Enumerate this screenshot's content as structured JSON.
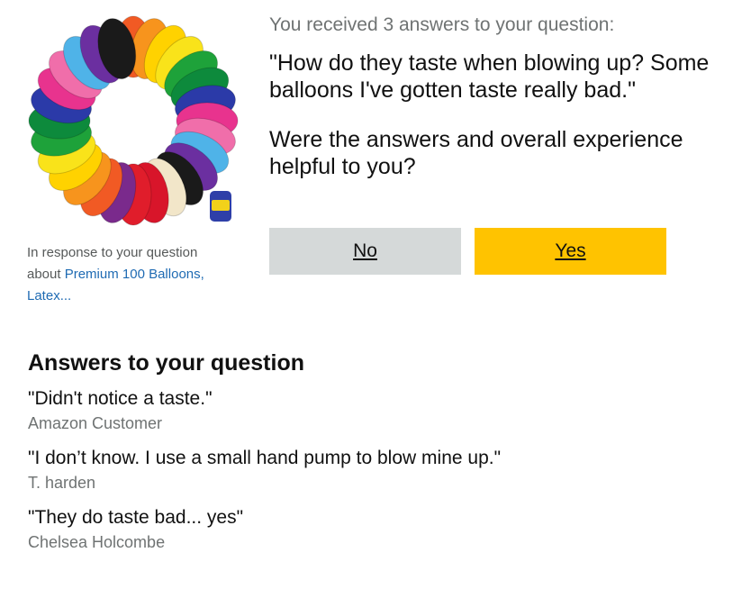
{
  "product": {
    "image_alt": "balloon-ring",
    "caption_prefix": "In response to your question about ",
    "link_text": "Premium 100 Balloons, Latex...",
    "balloon_colors": [
      "#f15a24",
      "#f7941d",
      "#ffd200",
      "#f9e31a",
      "#1ea23a",
      "#0d8a3c",
      "#2b3aa8",
      "#e8338e",
      "#f06eaa",
      "#4fb3e8",
      "#6b2fa0",
      "#1a1a1a",
      "#f2e6c9",
      "#d8152a",
      "#e01d2b",
      "#7a2a8c"
    ]
  },
  "header": {
    "received": "You received 3 answers to your question:",
    "question": "\"How do they taste when blowing up? Some balloons I've gotten taste really bad.\"",
    "helpful_prompt": "Were the answers and overall experience helpful to you?"
  },
  "buttons": {
    "no_label": "No",
    "yes_label": "Yes",
    "no_color": "#d5d9d9",
    "yes_color": "#ffc300"
  },
  "answers": {
    "heading": "Answers to your question",
    "items": [
      {
        "text": "\"Didn't notice a taste.\"",
        "author": "Amazon Customer"
      },
      {
        "text": "\"I don’t know. I use a small hand pump to blow mine up.\"",
        "author": "T. harden"
      },
      {
        "text": "\"They do taste bad... yes\"",
        "author": "Chelsea Holcombe"
      }
    ]
  }
}
